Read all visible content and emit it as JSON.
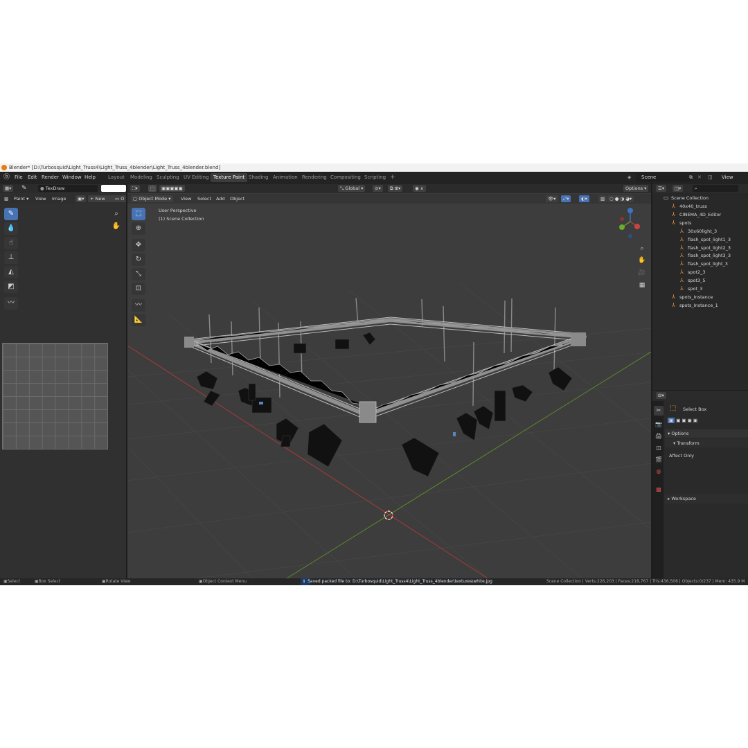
{
  "window": {
    "title": "Blender* [D:\\Turbosquid\\Light_Truss4\\Light_Truss_4blender\\Light_Truss_4blender.blend]"
  },
  "menu": [
    "File",
    "Edit",
    "Render",
    "Window",
    "Help"
  ],
  "workspaces": [
    {
      "label": "Layout",
      "active": false
    },
    {
      "label": "Modeling",
      "active": false
    },
    {
      "label": "Sculpting",
      "active": false
    },
    {
      "label": "UV Editing",
      "active": false
    },
    {
      "label": "Texture Paint",
      "active": true
    },
    {
      "label": "Shading",
      "active": false
    },
    {
      "label": "Animation",
      "active": false
    },
    {
      "label": "Rendering",
      "active": false
    },
    {
      "label": "Compositing",
      "active": false
    },
    {
      "label": "Scripting",
      "active": false
    }
  ],
  "scene": {
    "name": "Scene",
    "view_layer": "View Layer"
  },
  "image_editor": {
    "brush_name": "TexDraw",
    "mode": "Paint",
    "menus": [
      "View",
      "Image"
    ],
    "new_label": "New",
    "open_label": "O"
  },
  "viewport": {
    "mode": "Object Mode",
    "menus": [
      "View",
      "Select",
      "Add",
      "Object"
    ],
    "transform_orientation": "Global",
    "options_label": "Options",
    "perspective_label": "User Perspective",
    "collection_label": "(1) Scene Collection"
  },
  "outliner": {
    "root": "Scene Collection",
    "items": [
      {
        "name": "40x40_truss",
        "level": 1
      },
      {
        "name": "CINEMA_4D_Editor",
        "level": 1
      },
      {
        "name": "spots",
        "level": 1
      },
      {
        "name": "30x60light_3",
        "level": 2
      },
      {
        "name": "flash_spot_light1_3",
        "level": 2
      },
      {
        "name": "flash_spot_light2_3",
        "level": 2
      },
      {
        "name": "flash_spot_light3_3",
        "level": 2
      },
      {
        "name": "flash_spot_light_3",
        "level": 2
      },
      {
        "name": "spot2_3",
        "level": 2
      },
      {
        "name": "spot3_5",
        "level": 2
      },
      {
        "name": "spot_3",
        "level": 2
      },
      {
        "name": "spots_Instance",
        "level": 1
      },
      {
        "name": "spots_Instance_1",
        "level": 1
      }
    ]
  },
  "properties": {
    "tool_name": "Select Box",
    "options_label": "Options",
    "transform_label": "Transform",
    "affect_only_label": "Affect Only",
    "workspace_label": "Workspace"
  },
  "status": {
    "select": "Select",
    "box_select": "Box Select",
    "rotate_view": "Rotate View",
    "context_menu": "Object Context Menu",
    "message": "Saved packed file to: D:\\Turbosquid\\Light_Truss4\\Light_Truss_4blender\\textures\\white.jpg",
    "stats": "Scene Collection | Verts:226,203 | Faces:218,767 | Tris:436,506 | Objects:0/237 | Mem: 435.9 M"
  },
  "colors": {
    "accent": "#4772b3",
    "x_axis": "#a83a3a",
    "y_axis": "#5c8a2a",
    "object_orange": "#e9963c"
  }
}
